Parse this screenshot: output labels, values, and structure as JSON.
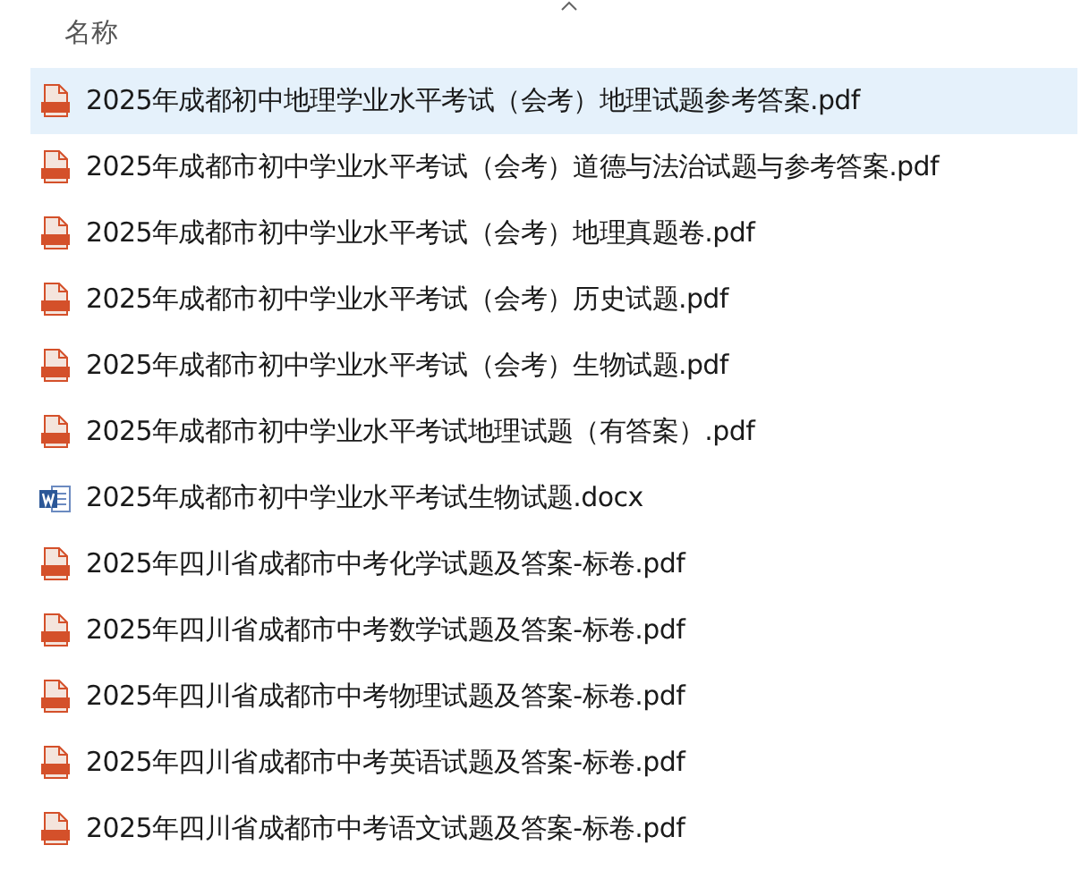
{
  "column_header": {
    "label": "名称",
    "sorted_ascending": true
  },
  "files": [
    {
      "name": "2025年成都初中地理学业水平考试（会考）地理试题参考答案.pdf",
      "kind": "pdf",
      "selected": true
    },
    {
      "name": "2025年成都市初中学业水平考试（会考）道德与法治试题与参考答案.pdf",
      "kind": "pdf",
      "selected": false
    },
    {
      "name": "2025年成都市初中学业水平考试（会考）地理真题卷.pdf",
      "kind": "pdf",
      "selected": false
    },
    {
      "name": "2025年成都市初中学业水平考试（会考）历史试题.pdf",
      "kind": "pdf",
      "selected": false
    },
    {
      "name": "2025年成都市初中学业水平考试（会考）生物试题.pdf",
      "kind": "pdf",
      "selected": false
    },
    {
      "name": "2025年成都市初中学业水平考试地理试题（有答案）.pdf",
      "kind": "pdf",
      "selected": false
    },
    {
      "name": "2025年成都市初中学业水平考试生物试题.docx",
      "kind": "docx",
      "selected": false
    },
    {
      "name": "2025年四川省成都市中考化学试题及答案-标卷.pdf",
      "kind": "pdf",
      "selected": false
    },
    {
      "name": "2025年四川省成都市中考数学试题及答案-标卷.pdf",
      "kind": "pdf",
      "selected": false
    },
    {
      "name": "2025年四川省成都市中考物理试题及答案-标卷.pdf",
      "kind": "pdf",
      "selected": false
    },
    {
      "name": "2025年四川省成都市中考英语试题及答案-标卷.pdf",
      "kind": "pdf",
      "selected": false
    },
    {
      "name": "2025年四川省成都市中考语文试题及答案-标卷.pdf",
      "kind": "pdf",
      "selected": false
    }
  ]
}
